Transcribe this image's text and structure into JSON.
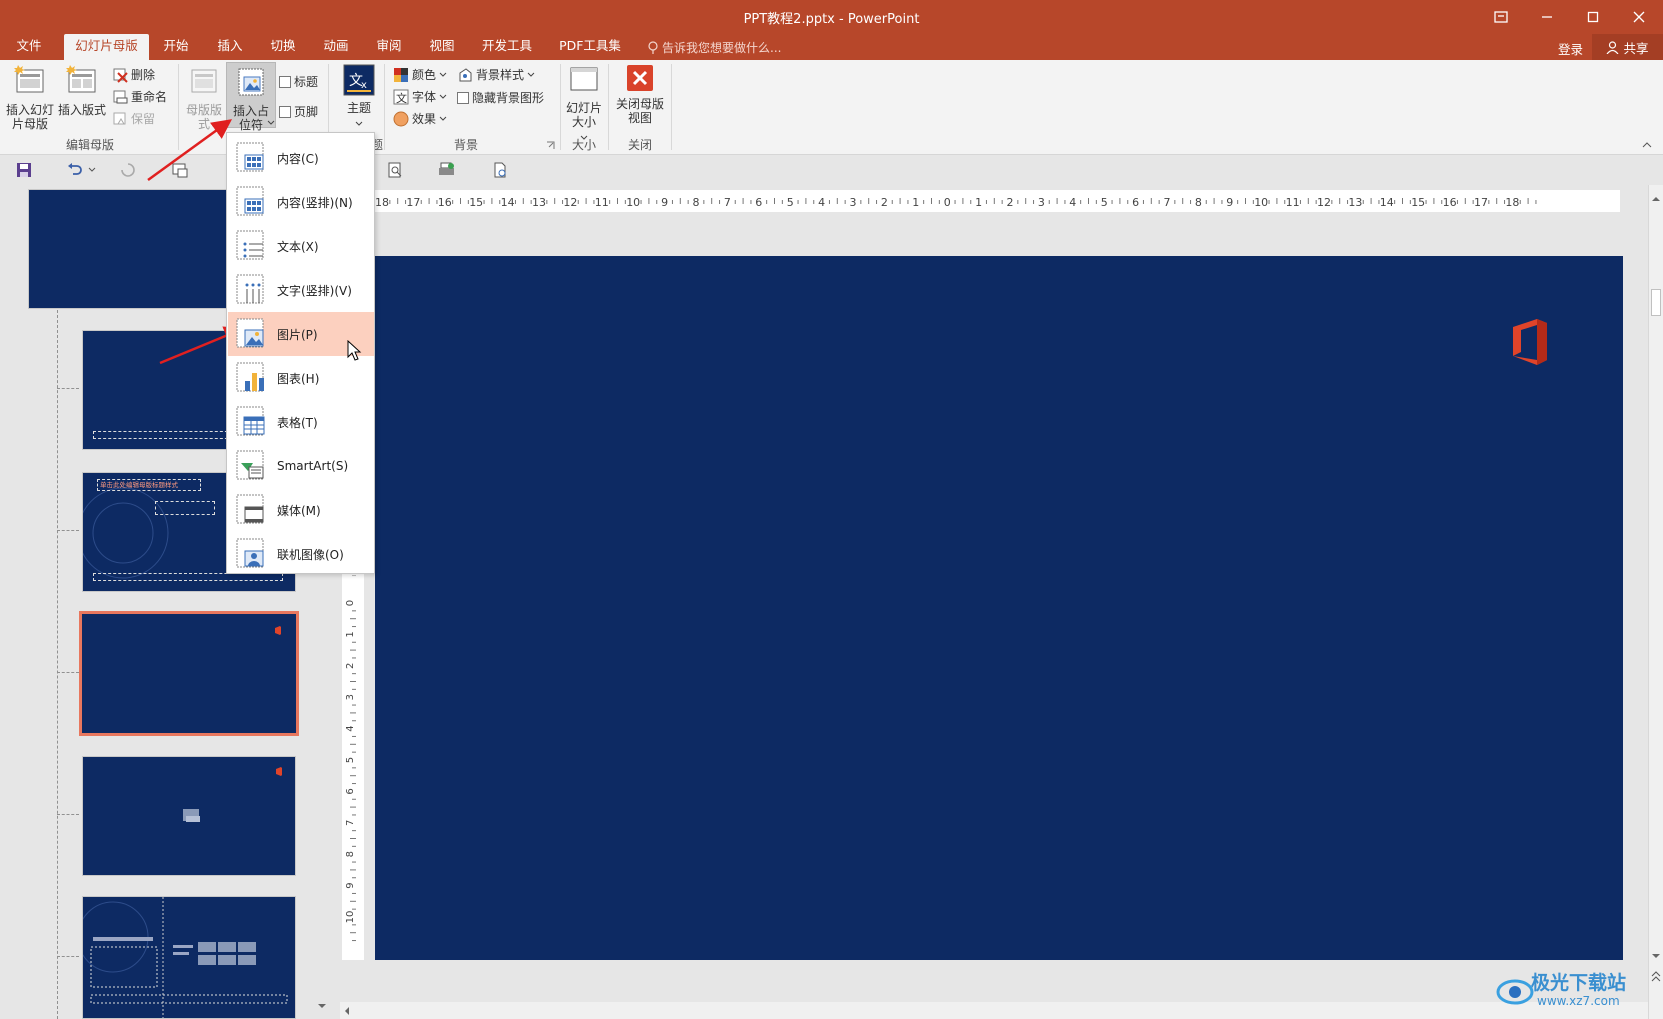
{
  "window": {
    "title": "PPT教程2.pptx - PowerPoint"
  },
  "tabs": [
    {
      "label": "文件"
    },
    {
      "label": "幻灯片母版"
    },
    {
      "label": "开始"
    },
    {
      "label": "插入"
    },
    {
      "label": "切换"
    },
    {
      "label": "动画"
    },
    {
      "label": "审阅"
    },
    {
      "label": "视图"
    },
    {
      "label": "开发工具"
    },
    {
      "label": "PDF工具集"
    }
  ],
  "tell_me": "告诉我您想要做什么...",
  "account": {
    "login": "登录",
    "share": "共享"
  },
  "ribbon": {
    "insert_master": "插入幻灯片母版",
    "insert_layout": "插入版式",
    "delete": "删除",
    "rename": "重命名",
    "preserve": "保留",
    "group_edit_master": "编辑母版",
    "master_layout": "母版版式",
    "insert_placeholder": "插入占位符",
    "title_checkbox": "标题",
    "footer_checkbox": "页脚",
    "theme": "主题",
    "group_theme_partial": "题",
    "colors": "颜色",
    "fonts": "字体",
    "effects": "效果",
    "background_styles": "背景样式",
    "hide_bg_graphics": "隐藏背景图形",
    "group_background": "背景",
    "slide_size": "幻灯片大小",
    "group_size": "大小",
    "close_master_view": "关闭母版视图",
    "group_close": "关闭"
  },
  "placeholder_menu": [
    {
      "label": "内容(C)",
      "icon": "content-placeholder-icon"
    },
    {
      "label": "内容(竖排)(N)",
      "icon": "content-vertical-placeholder-icon"
    },
    {
      "label": "文本(X)",
      "icon": "text-placeholder-icon"
    },
    {
      "label": "文字(竖排)(V)",
      "icon": "text-vertical-placeholder-icon"
    },
    {
      "label": "图片(P)",
      "icon": "picture-placeholder-icon",
      "hovered": true
    },
    {
      "label": "图表(H)",
      "icon": "chart-placeholder-icon"
    },
    {
      "label": "表格(T)",
      "icon": "table-placeholder-icon"
    },
    {
      "label": "SmartArt(S)",
      "icon": "smartart-placeholder-icon"
    },
    {
      "label": "媒体(M)",
      "icon": "media-placeholder-icon"
    },
    {
      "label": "联机图像(O)",
      "icon": "online-image-placeholder-icon"
    }
  ],
  "ruler": {
    "h_ticks": [
      "18",
      "17",
      "16",
      "15",
      "14",
      "13",
      "12",
      "11",
      "10",
      "9",
      "8",
      "7",
      "6",
      "5",
      "4",
      "3",
      "2",
      "1",
      "0",
      "1",
      "2",
      "3",
      "4",
      "5",
      "6",
      "7",
      "8",
      "9",
      "10",
      "11",
      "12",
      "13",
      "14",
      "15",
      "16",
      "17",
      "18"
    ],
    "v_ticks": [
      "0",
      "1",
      "2",
      "3",
      "4",
      "5",
      "6",
      "7",
      "8",
      "9",
      "10"
    ]
  },
  "thumbnails": {
    "slide2_title": "单击此处编辑母版标题样式"
  },
  "watermark": {
    "name": "极光下载站",
    "url": "www.xz7.com"
  },
  "colors": {
    "accent": "#b7472a",
    "slide_bg": "#0d2a63",
    "hover": "#fcd0bf",
    "arrow": "#e02020"
  }
}
